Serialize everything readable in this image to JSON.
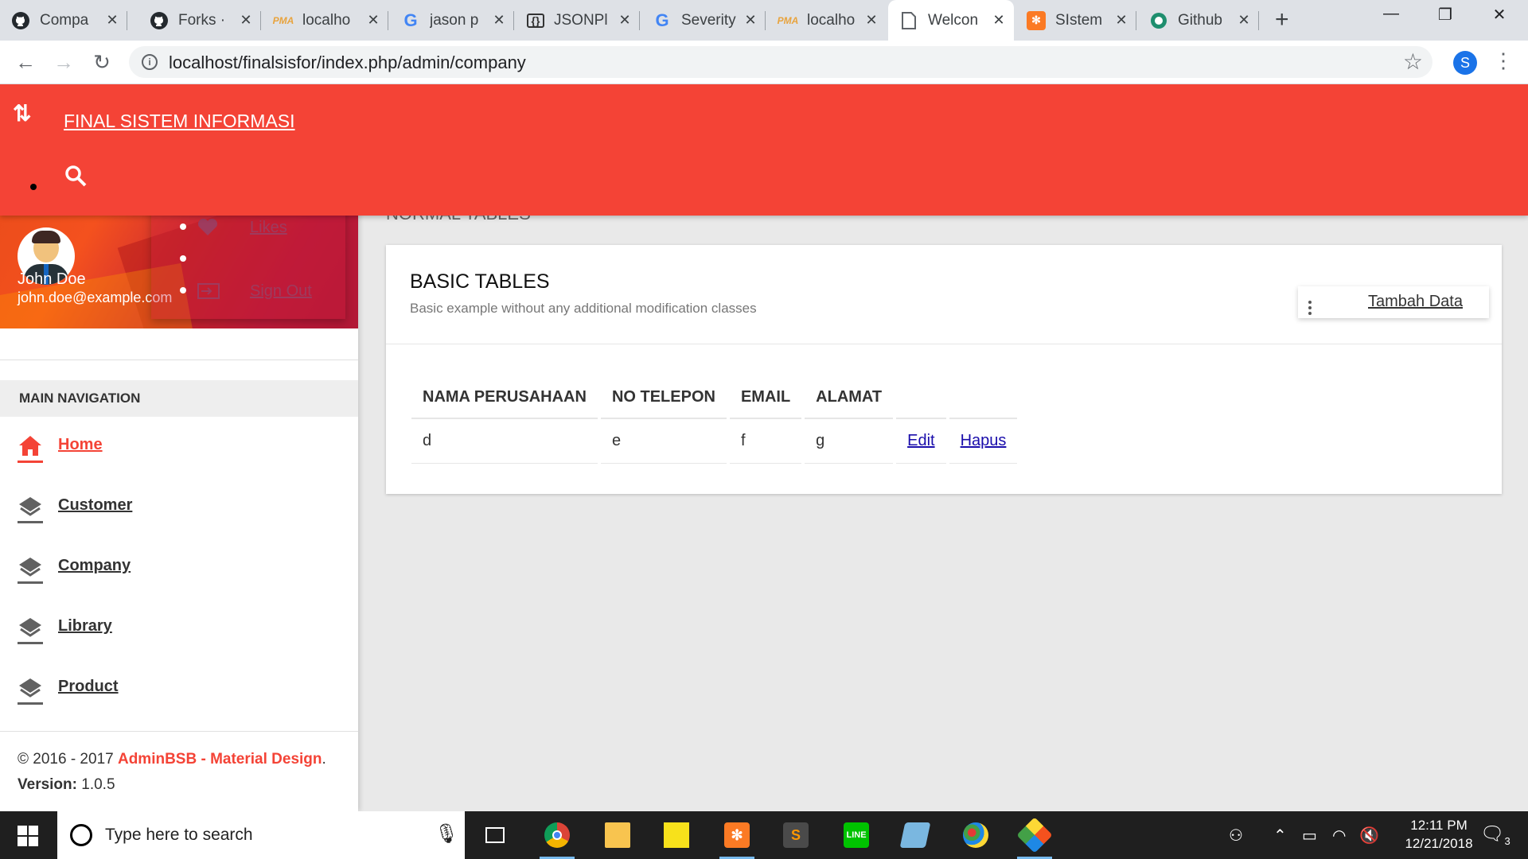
{
  "browser": {
    "tabs": [
      {
        "title": "Compa",
        "icon": "github-icon"
      },
      {
        "title": "Forks · ",
        "icon": "github-icon"
      },
      {
        "title": "localho",
        "icon": "phpmyadmin-icon"
      },
      {
        "title": "jason p",
        "icon": "google-icon"
      },
      {
        "title": "JSONPl",
        "icon": "jsonplaceholder-icon"
      },
      {
        "title": "Severity",
        "icon": "google-icon"
      },
      {
        "title": "localho",
        "icon": "phpmyadmin-icon"
      },
      {
        "title": "Welcon",
        "icon": "page-icon"
      },
      {
        "title": "SIstem",
        "icon": "xampp-icon"
      },
      {
        "title": "Github",
        "icon": "globe-icon"
      }
    ],
    "url": "localhost/finalsisfor/index.php/admin/company",
    "profile_initial": "S"
  },
  "appbar": {
    "brand": "FINAL SISTEM INFORMASI"
  },
  "user": {
    "name": "John Doe",
    "email": "john.doe@example.com",
    "menu": [
      "Likes",
      "Sign Out"
    ]
  },
  "sidebar": {
    "header": "MAIN NAVIGATION",
    "items": [
      {
        "label": "Home",
        "icon": "home-icon",
        "active": true
      },
      {
        "label": "Customer",
        "icon": "layers-icon"
      },
      {
        "label": "Company",
        "icon": "layers-icon"
      },
      {
        "label": "Library",
        "icon": "layers-icon"
      },
      {
        "label": "Product",
        "icon": "layers-icon"
      }
    ],
    "footer": {
      "copyright_prefix": "© 2016 - 2017 ",
      "brand": "AdminBSB - Material Design",
      "copyright_suffix": ".",
      "version_label": "Version: ",
      "version_value": "1.0.5"
    }
  },
  "content": {
    "block_header": "NORMAL TABLES",
    "card": {
      "title": "BASIC TABLES",
      "subtitle": "Basic example without any additional modification classes",
      "add_button": "Tambah Data",
      "columns": [
        "NAMA PERUSAHAAN",
        "NO TELEPON",
        "EMAIL",
        "ALAMAT"
      ],
      "rows": [
        {
          "nama": "d",
          "telepon": "e",
          "email": "f",
          "alamat": "g",
          "edit": "Edit",
          "hapus": "Hapus"
        }
      ]
    }
  },
  "taskbar": {
    "search_placeholder": "Type here to search",
    "time": "12:11 PM",
    "date": "12/21/2018",
    "notification_count": "3"
  },
  "colors": {
    "accent": "#f44336",
    "taskbar": "#1f1f1f"
  }
}
